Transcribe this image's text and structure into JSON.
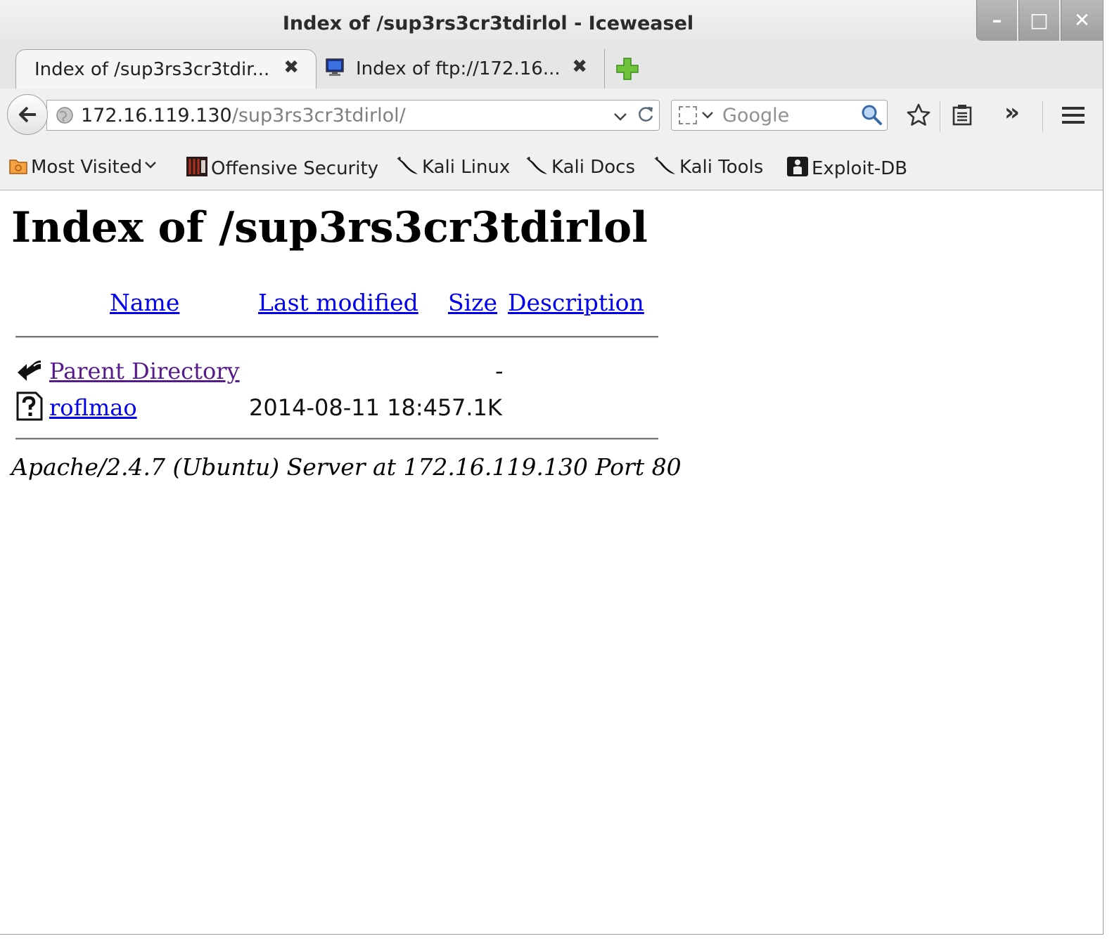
{
  "window": {
    "title": "Index of /sup3rs3cr3tdirlol - Iceweasel",
    "controls": {
      "minimize": "–",
      "maximize": "□",
      "close": "✕"
    }
  },
  "tabs": [
    {
      "label": "Index of /sup3rs3cr3tdir...",
      "close": "✖",
      "active": true
    },
    {
      "label": "Index of ftp://172.16...",
      "close": "✖",
      "active": false
    }
  ],
  "navbar": {
    "url_host": "172.16.119.130",
    "url_path": "/sup3rs3cr3tdirlol/",
    "search_placeholder": "Google",
    "overflow": "»"
  },
  "bookmarks": [
    {
      "label": "Most Visited",
      "icon": "folder-icon",
      "dropdown": true
    },
    {
      "label": "Offensive Security",
      "icon": "offsec-icon"
    },
    {
      "label": "Kali Linux",
      "icon": "kali-dragon-icon"
    },
    {
      "label": "Kali Docs",
      "icon": "kali-dragon-icon"
    },
    {
      "label": "Kali Tools",
      "icon": "kali-dragon-icon"
    },
    {
      "label": "Exploit-DB",
      "icon": "exploitdb-icon"
    }
  ],
  "page": {
    "heading": "Index of /sup3rs3cr3tdirlol",
    "columns": {
      "name": "Name",
      "last_modified": "Last modified",
      "size": "Size",
      "description": "Description"
    },
    "rows": [
      {
        "name": "Parent Directory",
        "modified": "",
        "size": "-",
        "icon": "back-arrow-icon"
      },
      {
        "name": "roflmao",
        "modified": "2014-08-11 18:45",
        "size": "7.1K",
        "icon": "unknown-file-icon"
      }
    ],
    "address": "Apache/2.4.7 (Ubuntu) Server at 172.16.119.130 Port 80"
  },
  "colors": {
    "link": "#0000ee",
    "visited_link": "#551a8b",
    "chrome_bg": "#f0f0f0"
  }
}
